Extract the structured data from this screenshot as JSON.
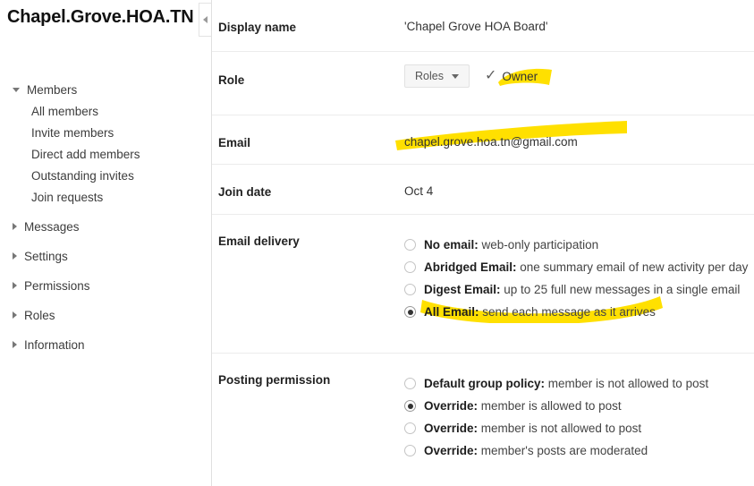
{
  "sidebar": {
    "group_title": "Chapel.Grove.HOA.TN",
    "collapse_tooltip": "◀",
    "sections": [
      {
        "label": "Members",
        "expanded": true,
        "children": [
          {
            "label": "All members"
          },
          {
            "label": "Invite members"
          },
          {
            "label": "Direct add members"
          },
          {
            "label": "Outstanding invites"
          },
          {
            "label": "Join requests"
          }
        ]
      },
      {
        "label": "Messages",
        "expanded": false,
        "children": []
      },
      {
        "label": "Settings",
        "expanded": false,
        "children": []
      },
      {
        "label": "Permissions",
        "expanded": false,
        "children": []
      },
      {
        "label": "Roles",
        "expanded": false,
        "children": []
      },
      {
        "label": "Information",
        "expanded": false,
        "children": []
      }
    ]
  },
  "main": {
    "display_name": {
      "label": "Display name",
      "value": "'Chapel Grove HOA Board'"
    },
    "role": {
      "label": "Role",
      "dropdown_label": "Roles",
      "check_glyph": "✓",
      "current_role": "Owner",
      "highlighted": true
    },
    "email": {
      "label": "Email",
      "value": "chapel.grove.hoa.tn@gmail.com",
      "highlighted": true
    },
    "join_date": {
      "label": "Join date",
      "value": "Oct 4"
    },
    "email_delivery": {
      "label": "Email delivery",
      "options": [
        {
          "strong": "No email:",
          "rest": " web-only participation",
          "selected": false,
          "highlighted": false
        },
        {
          "strong": "Abridged Email:",
          "rest": " one summary email of new activity per day",
          "selected": false,
          "highlighted": false
        },
        {
          "strong": "Digest Email:",
          "rest": " up to 25 full new messages in a single email",
          "selected": false,
          "highlighted": false
        },
        {
          "strong": "All Email:",
          "rest": " send each message as it arrives",
          "selected": true,
          "highlighted": true
        }
      ]
    },
    "posting_permission": {
      "label": "Posting permission",
      "options": [
        {
          "strong": "Default group policy:",
          "rest": " member is not allowed to post",
          "selected": false,
          "highlighted": false
        },
        {
          "strong": "Override:",
          "rest": " member is allowed to post",
          "selected": true,
          "highlighted": false
        },
        {
          "strong": "Override:",
          "rest": " member is not allowed to post",
          "selected": false,
          "highlighted": false
        },
        {
          "strong": "Override:",
          "rest": " member's posts are moderated",
          "selected": false,
          "highlighted": false
        }
      ]
    }
  },
  "colors": {
    "highlighter": "#ffe000",
    "divider": "#ececec",
    "sidebar_border": "#e0e0e0",
    "text": "#333333",
    "radio_border": "#c4c4c4"
  }
}
